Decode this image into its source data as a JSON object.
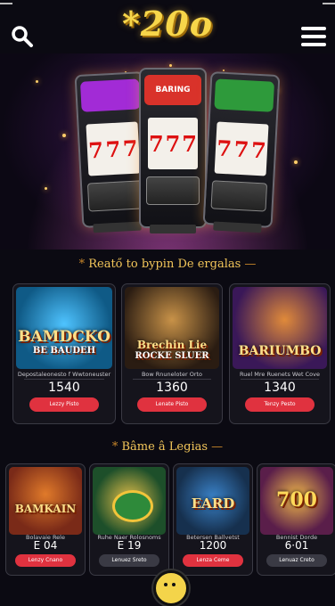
{
  "header": {
    "logo": "*20o",
    "search_icon": "search-icon",
    "menu_icon": "hamburger-menu-icon"
  },
  "hero": {
    "machines": [
      {
        "top_label": "",
        "reel": [
          "7",
          "7",
          "7"
        ],
        "color": "#a22bd6"
      },
      {
        "top_label": "BARING",
        "reel": [
          "7",
          "7",
          "7"
        ],
        "color": "#d9322a"
      },
      {
        "top_label": "",
        "reel": [
          "7",
          "7",
          "7"
        ],
        "color": "#2e9a3b"
      }
    ]
  },
  "section1": {
    "title": "Reatő to bypin De ergalas",
    "cards": [
      {
        "art_title_1": "BAMDCKO",
        "art_title_2": "BE BAUDEH",
        "subtitle": "Depostaleonesto f Wwtoneuster",
        "value": "1540",
        "button": "Lezzy Pisto",
        "art_bg": "#0f5a86"
      },
      {
        "art_title_1": "Brechin Lie",
        "art_title_2": "ROCKE SLUER",
        "subtitle": "Bow Rnuneloter Orto",
        "value": "1360",
        "button": "Lenate Pisto",
        "art_bg": "#2a1c12"
      },
      {
        "art_title_1": "BARIUMBO",
        "art_title_2": "",
        "subtitle": "Ruel Mre Ruenets Wet Cove",
        "value": "1340",
        "button": "Tenzy Pesto",
        "art_bg": "#3a1858"
      }
    ]
  },
  "section2": {
    "title": "Bâme â Legias",
    "cards": [
      {
        "art_title_1": "BAMKAIN",
        "art_title_2": "",
        "subtitle": "Bolavaie Rele",
        "value": "E 04",
        "button": "Lenzy Cnano",
        "art_bg": "#7a2a18"
      },
      {
        "art_title_1": "",
        "art_title_2": "",
        "subtitle": "Ruhe Naer Rolosnoms",
        "value": "E 19",
        "button": "Lenuez Sreto",
        "art_bg": "#1d4f2a"
      },
      {
        "art_title_1": "EARD",
        "art_title_2": "",
        "subtitle": "Betersen Ballvetst",
        "value": "1200",
        "button": "Lenza Ceme",
        "art_bg": "#16304e"
      },
      {
        "art_title_1": "700",
        "art_title_2": "",
        "subtitle": "Bennist Dorde",
        "value": "6·01",
        "button": "Lenuaz Creto",
        "art_bg": "#5a1e4a"
      }
    ]
  }
}
